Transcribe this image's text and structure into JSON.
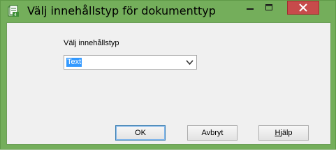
{
  "window": {
    "title": "Välj innehållstyp för dokumenttyp",
    "controls": {
      "minimize": "minimize",
      "maximize": "maximize",
      "close": "close"
    },
    "colors": {
      "frame": "#74ae5b",
      "close_button": "#c74b4b",
      "client_bg": "#f0f0f0"
    }
  },
  "form": {
    "label": "Välj innehållstyp",
    "content_type": {
      "selected": "Text"
    }
  },
  "buttons": {
    "ok": "OK",
    "cancel": "Avbryt",
    "help_mnemonic": "H",
    "help_rest": "jälp"
  }
}
